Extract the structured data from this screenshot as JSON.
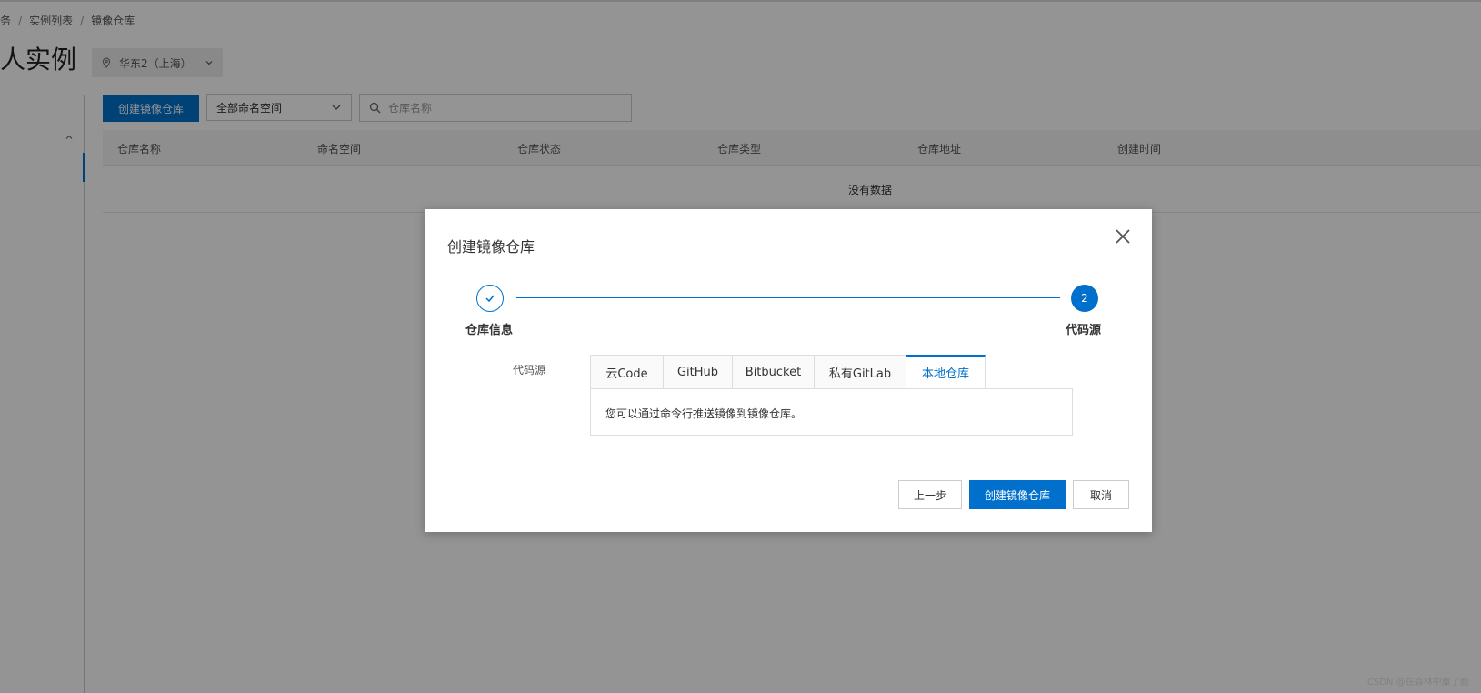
{
  "breadcrumb": {
    "item1": "务",
    "item2": "实例列表",
    "item3": "镜像仓库",
    "separator": "/"
  },
  "page_title": "人实例",
  "region": {
    "label": "华东2（上海）"
  },
  "toolbar": {
    "create_button": "创建镜像仓库",
    "namespace_select": "全部命名空间",
    "search_placeholder": "仓库名称"
  },
  "table": {
    "columns": [
      "仓库名称",
      "命名空间",
      "仓库状态",
      "仓库类型",
      "仓库地址",
      "创建时间"
    ],
    "empty_text": "没有数据"
  },
  "modal": {
    "title": "创建镜像仓库",
    "steps": [
      {
        "label": "仓库信息",
        "status": "done"
      },
      {
        "number": "2",
        "label": "代码源",
        "status": "current"
      }
    ],
    "field_label": "代码源",
    "tabs": [
      "云Code",
      "GitHub",
      "Bitbucket",
      "私有GitLab",
      "本地仓库"
    ],
    "active_tab": "本地仓库",
    "panel_text": "您可以通过命令行推送镜像到镜像仓库。",
    "buttons": {
      "prev": "上一步",
      "submit": "创建镜像仓库",
      "cancel": "取消"
    }
  },
  "watermark": "CSDN @在森林中麋了鹿",
  "colors": {
    "primary": "#0070cc",
    "overlay": "rgba(0,0,0,0.42)"
  },
  "icons": [
    "location-pin-icon",
    "chevron-down-icon",
    "search-icon",
    "chevron-up-icon",
    "close-icon",
    "check-icon"
  ]
}
